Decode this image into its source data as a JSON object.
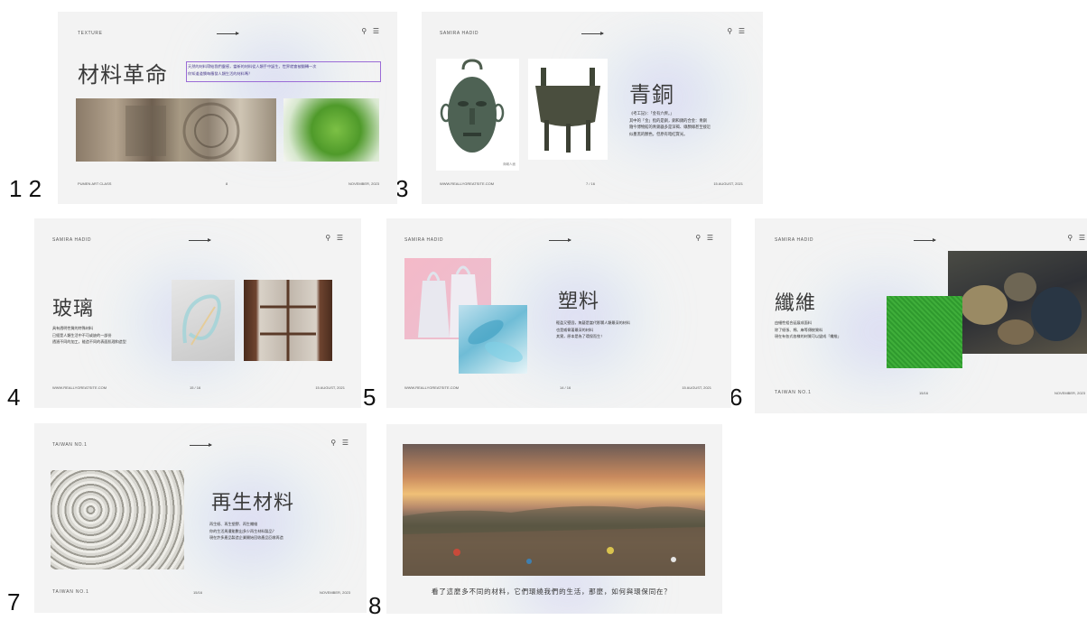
{
  "page_labels": [
    "1 2",
    "3",
    "4",
    "5",
    "6",
    "7",
    "8"
  ],
  "slides": [
    {
      "header": "TEXTURE",
      "icons": "⚲ ☰",
      "title": "材料革命",
      "body": "天然的材料帶給我們靈感，當新的材料從人類手中誕生，世界就會被翻轉一次\n你知道道慣每應發人類生活的材料嗎？",
      "footer_left": "PUMEN ART CLASS",
      "footer_mid": "8",
      "footer_right": "NOVEMBER, 2023"
    },
    {
      "header": "SAMIRA HADID",
      "icons": "⚲ ☰",
      "title": "青銅",
      "image_caption": "商朝人面",
      "body": "《考工記》：「金有六齊。」\n其中的「金」指的是銅，銅和錫的合金：青銅\n隨今博物館的青銅器多是深褐、綠顏綠甚至接近\n似墨黑的顏色，但原有暗紅寶光。",
      "footer_left": "WWW.REALLYGREATSITE.COM",
      "footer_mid": "7 / 16",
      "footer_right": "15 AUGUST, 2021"
    },
    {
      "header": "SAMIRA HADID",
      "icons": "⚲ ☰",
      "title": "玻璃",
      "body": "具有透明性質的特殊材料\n已經是人類生活中不可或缺的一部份\n透過不同的加工，能造不同的表面肌理和造型",
      "footer_left": "WWW.REALLYGREATSITE.COM",
      "footer_mid": "15 / 16",
      "footer_right": "15 AUGUST, 2021"
    },
    {
      "header": "SAMIRA HADID",
      "icons": "⚲ ☰",
      "title": "塑料",
      "body": "輕盈又堅固，無疑是當代影響人類最深的材料\n也是威脅著最深的材料\n其實，原本是為了環保而生！",
      "footer_left": "WWW.REALLYGREATSITE.COM",
      "footer_mid": "14 / 16",
      "footer_right": "15 AUGUST, 2021"
    },
    {
      "header": "SAMIRA HADID",
      "icons": "⚲ ☰",
      "title": "纖維",
      "body": "由細性組合延展成面料\n除了紙張、棉、麻等傳統質料\n現在有各式各樣的材質可以變成「纖維」",
      "footer_left": "TAIWAN NO.1",
      "footer_mid": "15/16",
      "footer_right": "NOVEMBER, 2023"
    },
    {
      "header": "TAIWAN NO.1",
      "icons": "⚲ ☰",
      "title": "再生材料",
      "body": "再生紙、再生塑膠、再生纖維\n你的生活周遭能數出多少再生材料製品？\n現在許多產品製造企業開始回收產品回收再造",
      "footer_left": "TAIWAN NO.1",
      "footer_mid": "15/16",
      "footer_right": "NOVEMBER, 2023"
    },
    {
      "caption": "看了這麼多不同的材料，它們環繞我們的生活，那麼，如何與環保同在？"
    }
  ],
  "colors": {
    "slide_bg": "#f3f3f3",
    "highlight_box": "#9a6bd6",
    "text": "#333333"
  }
}
